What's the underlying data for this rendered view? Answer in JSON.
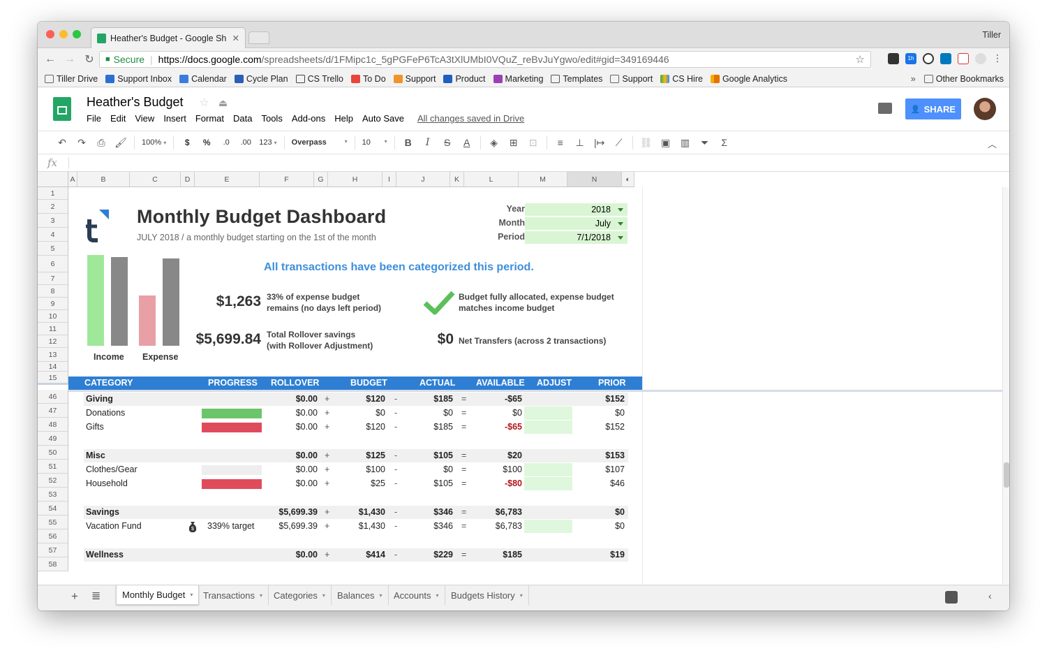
{
  "browser": {
    "tab_title": "Heather's Budget - Google Sh",
    "profile": "Tiller",
    "secure_label": "Secure",
    "url_scheme_host": "https://docs.google.com",
    "url_path": "/spreadsheets/d/1FMipc1c_5gPGFeP6TcA3tXlUMbI0VQuZ_reBvJuYgwo/edit#gid=349169446",
    "ext_badge": "1h"
  },
  "bookmarks": [
    "Tiller Drive",
    "Support Inbox",
    "Calendar",
    "Cycle Plan",
    "CS Trello",
    "To Do",
    "Support",
    "Product",
    "Marketing",
    "Templates",
    "Support",
    "CS Hire",
    "Google Analytics"
  ],
  "bookmarks_overflow": "»",
  "other_bookmarks": "Other Bookmarks",
  "sheets": {
    "title": "Heather's Budget",
    "menus": [
      "File",
      "Edit",
      "View",
      "Insert",
      "Format",
      "Data",
      "Tools",
      "Add-ons",
      "Help",
      "Auto Save"
    ],
    "saved_status": "All changes saved in Drive",
    "share_label": "SHARE"
  },
  "toolbar": {
    "zoom": "100%",
    "currency": "$",
    "percent": "%",
    "dec_less": ".0",
    "dec_more": ".00",
    "number_format": "123",
    "font": "Overpass",
    "font_size": "10"
  },
  "formula_bar": {
    "fx": "fx",
    "value": ""
  },
  "columns": [
    "A",
    "B",
    "C",
    "D",
    "E",
    "F",
    "G",
    "H",
    "I",
    "J",
    "K",
    "L",
    "M",
    "N"
  ],
  "rows_top": [
    "1",
    "2",
    "3",
    "4",
    "5",
    "6",
    "7",
    "8",
    "9",
    "10",
    "11",
    "12",
    "13",
    "14",
    "15"
  ],
  "rows_bottom": [
    "46",
    "47",
    "48",
    "49",
    "50",
    "51",
    "52",
    "53",
    "54",
    "55",
    "56",
    "57",
    "58"
  ],
  "dashboard": {
    "title": "Monthly Budget Dashboard",
    "subtitle": "JULY 2018 / a monthly budget starting on the 1st of the month",
    "selectors": [
      {
        "label": "Year",
        "value": "2018"
      },
      {
        "label": "Month",
        "value": "July"
      },
      {
        "label": "Period",
        "value": "7/1/2018"
      }
    ],
    "categorized_message": "All transactions have been categorized this period.",
    "remaining_amount": "$1,263",
    "remaining_desc_1": "33% of expense budget",
    "remaining_desc_2": "remains (no days left period)",
    "rollover_amount": "$5,699.84",
    "rollover_desc_1": "Total Rollover savings",
    "rollover_desc_2": "(with Rollover Adjustment)",
    "allocated_desc_1": "Budget fully allocated, expense budget",
    "allocated_desc_2": "matches income budget",
    "transfers_amount": "$0",
    "transfers_desc": "Net Transfers (across 2 transactions)",
    "bar_labels": [
      "Income",
      "Expense"
    ]
  },
  "chart_data": {
    "type": "bar",
    "categories": [
      "Income",
      "Expense"
    ],
    "series": [
      {
        "values": [
          1.0,
          0.55
        ]
      },
      {
        "values": [
          0.98,
          0.96
        ]
      }
    ],
    "colors": [
      "#9fe89a",
      "#888888",
      "#e8a0a6",
      "#888888"
    ]
  },
  "table_header": [
    "CATEGORY",
    "PROGRESS",
    "ROLLOVER",
    "BUDGET",
    "ACTUAL",
    "AVAILABLE",
    "ADJUST",
    "PRIOR"
  ],
  "table_rows": [
    {
      "name": "Giving",
      "group": true,
      "rollover": "$0.00",
      "plus": "+",
      "budget": "$120",
      "minus": "-",
      "actual": "$185",
      "eq": "=",
      "available": "-$65",
      "prior": "$152"
    },
    {
      "name": "Donations",
      "group": false,
      "progress": 1.0,
      "progress_color": "#6cc56a",
      "rollover": "$0.00",
      "plus": "+",
      "budget": "$0",
      "minus": "-",
      "actual": "$0",
      "eq": "=",
      "available": "$0",
      "prior": "$0"
    },
    {
      "name": "Gifts",
      "group": false,
      "progress": 1.0,
      "progress_color": "#e04b5c",
      "rollover": "$0.00",
      "plus": "+",
      "budget": "$120",
      "minus": "-",
      "actual": "$185",
      "eq": "=",
      "available": "-$65",
      "available_neg": true,
      "prior": "$152"
    },
    {
      "name": "Misc",
      "group": true,
      "rollover": "$0.00",
      "plus": "+",
      "budget": "$125",
      "minus": "-",
      "actual": "$105",
      "eq": "=",
      "available": "$20",
      "prior": "$153"
    },
    {
      "name": "Clothes/Gear",
      "group": false,
      "progress": 0.0,
      "progress_color": "#eeeeee",
      "rollover": "$0.00",
      "plus": "+",
      "budget": "$100",
      "minus": "-",
      "actual": "$0",
      "eq": "=",
      "available": "$100",
      "prior": "$107"
    },
    {
      "name": "Household",
      "group": false,
      "progress": 1.0,
      "progress_color": "#e04b5c",
      "rollover": "$0.00",
      "plus": "+",
      "budget": "$25",
      "minus": "-",
      "actual": "$105",
      "eq": "=",
      "available": "-$80",
      "available_neg": true,
      "prior": "$46"
    },
    {
      "name": "Savings",
      "group": true,
      "rollover": "$5,699.39",
      "plus": "+",
      "budget": "$1,430",
      "minus": "-",
      "actual": "$346",
      "eq": "=",
      "available": "$6,783",
      "prior": "$0"
    },
    {
      "name": "Vacation Fund",
      "group": false,
      "target": "339% target",
      "rollover": "$5,699.39",
      "plus": "+",
      "budget": "$1,430",
      "minus": "-",
      "actual": "$346",
      "eq": "=",
      "available": "$6,783",
      "prior": "$0"
    },
    {
      "name": "Wellness",
      "group": true,
      "rollover": "$0.00",
      "plus": "+",
      "budget": "$414",
      "minus": "-",
      "actual": "$229",
      "eq": "=",
      "available": "$185",
      "prior": "$19"
    }
  ],
  "sheet_tabs": [
    "Monthly Budget",
    "Transactions",
    "Categories",
    "Balances",
    "Accounts",
    "Budgets History"
  ],
  "colors": {
    "accent_blue": "#2e7fd3",
    "selector_green": "#d9f5d4",
    "sheets_green": "#23a566"
  }
}
